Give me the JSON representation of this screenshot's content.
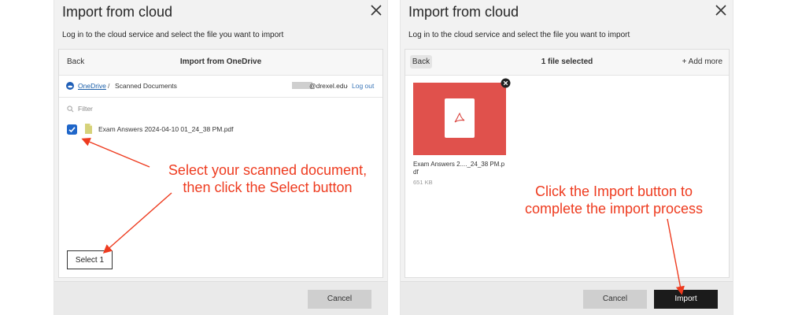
{
  "left": {
    "title": "Import from cloud",
    "subtitle": "Log in to the cloud service and select the file you want to import",
    "header": {
      "back_label": "Back",
      "title": "Import from OneDrive"
    },
    "breadcrumb": {
      "provider": "OneDrive",
      "separator": "/",
      "folder": "Scanned Documents"
    },
    "account": {
      "email": "@drexel.edu",
      "separator": "·",
      "logout_label": "Log out"
    },
    "filter_placeholder": "Filter",
    "file": {
      "name": "Exam Answers 2024-04-10 01_24_38 PM.pdf",
      "checked": true
    },
    "select_label": "Select 1",
    "cancel_label": "Cancel"
  },
  "right": {
    "title": "Import from cloud",
    "subtitle": "Log in to the cloud service and select the file you want to import",
    "header": {
      "back_label": "Back",
      "status": "1 file selected",
      "add_more_label": "+ Add more"
    },
    "file": {
      "name_line1": "Exam Answers 2...._24_38 PM.p",
      "name_line2": "df",
      "size": "651 KB",
      "thumb_color": "#e0514c"
    },
    "cancel_label": "Cancel",
    "import_label": "Import"
  },
  "annotations": {
    "left_line1": "Select your scanned document,",
    "left_line2": "then click the Select button",
    "right_line1": "Click the Import button to",
    "right_line2": "complete the import process",
    "color": "#ee3b1f"
  },
  "icons": {
    "close": "close-icon",
    "onedrive": "onedrive-icon",
    "search": "search-icon",
    "file": "file-icon",
    "pdf": "pdf-icon",
    "remove": "remove-file-icon"
  }
}
